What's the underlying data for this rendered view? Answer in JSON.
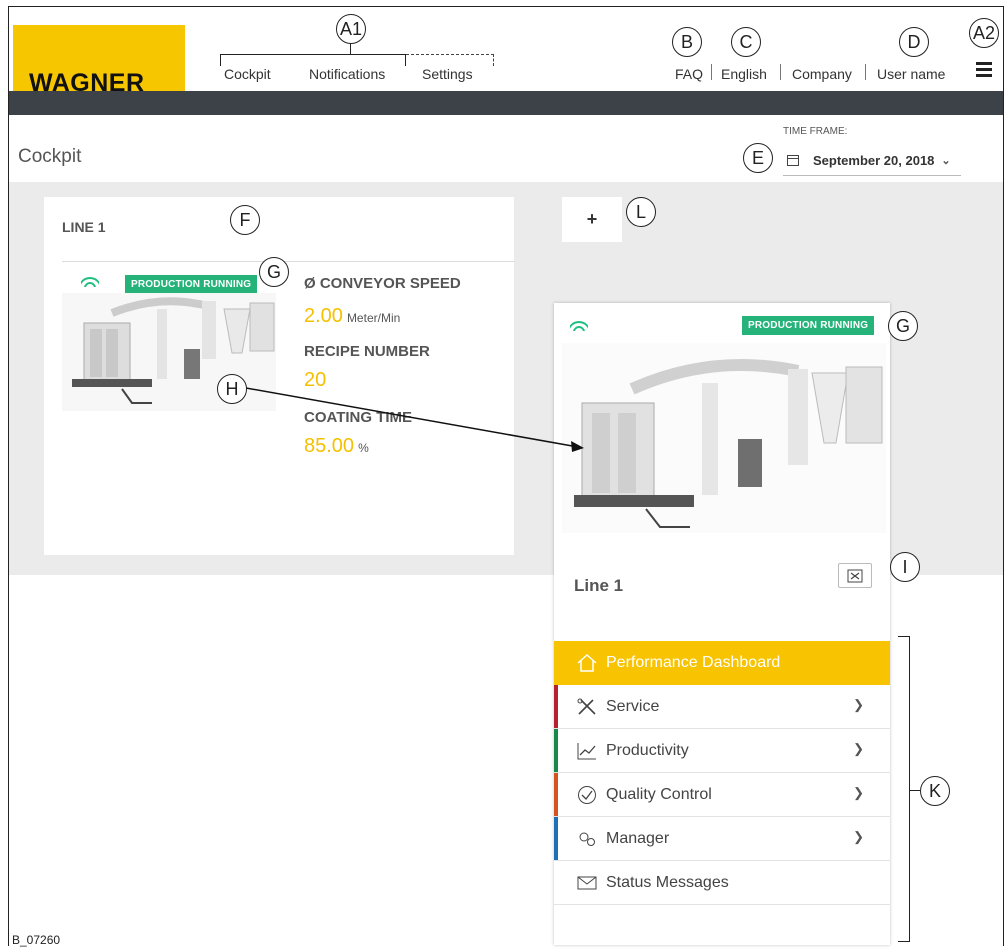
{
  "brand": {
    "logo_text": "WAGNER",
    "accent": "#f8c300",
    "status_green": "#25b37a"
  },
  "topnav": {
    "left": [
      "Cockpit",
      "Notifications",
      "Settings"
    ],
    "right": [
      "FAQ",
      "English",
      "Company",
      "User name"
    ]
  },
  "callouts": {
    "a1": "A1",
    "a2": "A2",
    "b": "B",
    "c": "C",
    "d": "D",
    "e": "E",
    "f": "F",
    "g": "G",
    "h": "H",
    "i": "I",
    "k": "K",
    "l": "L"
  },
  "page": {
    "title": "Cockpit"
  },
  "time_frame": {
    "label": "TIME FRAME:",
    "value": "September 20, 2018"
  },
  "line_card": {
    "title": "LINE 1",
    "status": "PRODUCTION RUNNING",
    "metrics": [
      {
        "label": "Ø CONVEYOR SPEED",
        "value": "2.00",
        "unit": "Meter/Min"
      },
      {
        "label": "RECIPE NUMBER",
        "value": "20",
        "unit": ""
      },
      {
        "label": "COATING TIME",
        "value": "85.00",
        "unit": "%"
      }
    ]
  },
  "add_button": {
    "label": "+"
  },
  "detail_card": {
    "status": "PRODUCTION RUNNING",
    "title": "Line 1",
    "menu": [
      {
        "label": "Performance Dashboard",
        "icon": "home-icon",
        "active": true
      },
      {
        "label": "Service",
        "icon": "tools-icon",
        "color": "#b5202e"
      },
      {
        "label": "Productivity",
        "icon": "chart-icon",
        "color": "#16894a"
      },
      {
        "label": "Quality Control",
        "icon": "check-circle-icon",
        "color": "#d3541f"
      },
      {
        "label": "Manager",
        "icon": "gears-icon",
        "color": "#1f6fb5"
      },
      {
        "label": "Status Messages",
        "icon": "envelope-icon"
      }
    ]
  },
  "caption": "B_07260"
}
